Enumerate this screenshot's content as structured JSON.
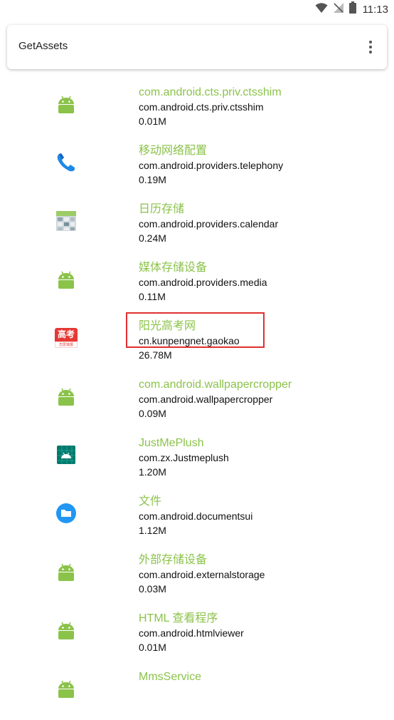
{
  "status_bar": {
    "time": "11:13"
  },
  "toolbar": {
    "title": "GetAssets"
  },
  "apps": [
    {
      "name": "com.android.cts.priv.ctsshim",
      "package": "com.android.cts.priv.ctsshim",
      "size": "0.01M",
      "icon": "android-icon"
    },
    {
      "name": "移动网络配置",
      "package": "com.android.providers.telephony",
      "size": "0.19M",
      "icon": "phone-icon"
    },
    {
      "name": "日历存储",
      "package": "com.android.providers.calendar",
      "size": "0.24M",
      "icon": "calendar-icon"
    },
    {
      "name": "媒体存储设备",
      "package": "com.android.providers.media",
      "size": "0.11M",
      "icon": "android-icon"
    },
    {
      "name": "阳光高考网",
      "package": "cn.kunpengnet.gaokao",
      "size": "26.78M",
      "icon": "gaokao-icon",
      "icon_text": "高考",
      "icon_subtext": "志愿填报"
    },
    {
      "name": "com.android.wallpapercropper",
      "package": "com.android.wallpapercropper",
      "size": "0.09M",
      "icon": "android-icon"
    },
    {
      "name": "JustMePlush",
      "package": "com.zx.Justmeplush",
      "size": "1.20M",
      "icon": "android-grid-icon"
    },
    {
      "name": "文件",
      "package": "com.android.documentsui",
      "size": "1.12M",
      "icon": "folder-icon"
    },
    {
      "name": "外部存储设备",
      "package": "com.android.externalstorage",
      "size": "0.03M",
      "icon": "android-icon"
    },
    {
      "name": "HTML 查看程序",
      "package": "com.android.htmlviewer",
      "size": "0.01M",
      "icon": "android-icon"
    },
    {
      "name": "MmsService",
      "package": "",
      "size": "",
      "icon": "android-icon"
    }
  ],
  "colors": {
    "app_name": "#8BC34A",
    "highlight": "#E03030",
    "android_green": "#8BC34A"
  }
}
